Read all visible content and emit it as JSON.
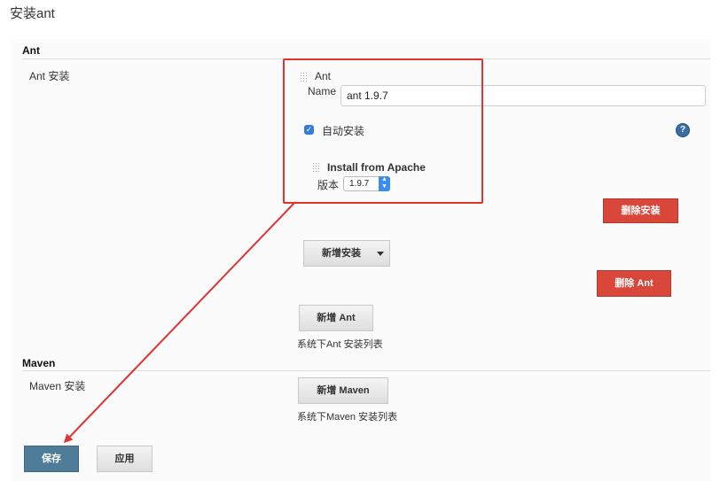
{
  "page": {
    "title": "安装ant"
  },
  "ant": {
    "section_title": "Ant",
    "row_label": "Ant 安装",
    "installer": {
      "header": "Ant",
      "name_label": "Name",
      "name_value": "ant 1.9.7",
      "auto_install_label": "自动安装",
      "auto_install_checked": true,
      "help_icon_text": "?",
      "source": {
        "title": "Install from Apache",
        "version_label": "版本",
        "version_value": "1.9.7"
      },
      "delete_installer_label": "删除安装"
    },
    "add_installer_label": "新增安装",
    "delete_ant_label": "删除 Ant",
    "add_ant_label": "新增 Ant",
    "list_note": "系统下Ant 安装列表"
  },
  "maven": {
    "section_title": "Maven",
    "row_label": "Maven 安装",
    "add_maven_label": "新增 Maven",
    "list_note": "系统下Maven 安装列表"
  },
  "footer": {
    "save_label": "保存",
    "apply_label": "应用"
  },
  "colors": {
    "danger": "#d9473b",
    "primary": "#4f7c98",
    "annotation": "#e13333",
    "checkbox": "#2f7ed8"
  }
}
